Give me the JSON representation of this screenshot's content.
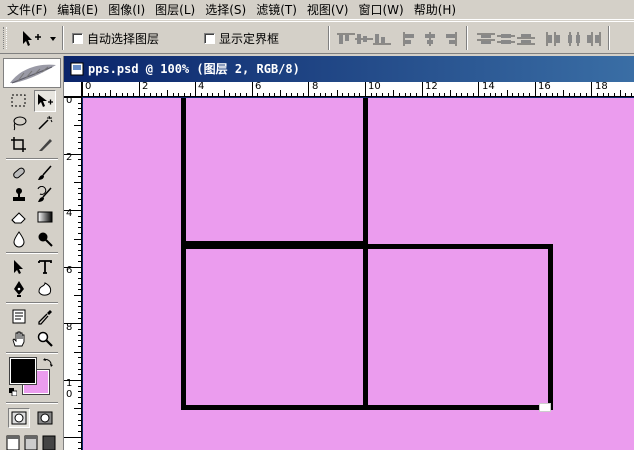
{
  "menu": {
    "items": [
      "文件(F)",
      "编辑(E)",
      "图像(I)",
      "图层(L)",
      "选择(S)",
      "滤镜(T)",
      "视图(V)",
      "窗口(W)",
      "帮助(H)"
    ]
  },
  "options": {
    "auto_select_label": "自动选择图层",
    "show_bounds_label": "显示定界框"
  },
  "document": {
    "title": "pps.psd @ 100% (图层 2, RGB/8)"
  },
  "rulers": {
    "horizontal": [
      "0",
      "2",
      "4",
      "6",
      "8",
      "10",
      "12",
      "14",
      "16",
      "18"
    ],
    "vertical": [
      "0",
      "2",
      "4",
      "6",
      "8",
      "1",
      "0"
    ]
  },
  "colors": {
    "foreground": "#000000",
    "background": "#eb9cee",
    "canvas": "#eb9cee",
    "titlebar": "#0a246a"
  },
  "icons": {
    "toolbox": [
      "marquee-icon",
      "move-icon",
      "lasso-icon",
      "magic-wand-icon",
      "crop-icon",
      "slice-icon",
      "healing-brush-icon",
      "brush-icon",
      "clone-stamp-icon",
      "history-brush-icon",
      "eraser-icon",
      "gradient-icon",
      "blur-icon",
      "dodge-icon",
      "path-select-icon",
      "type-icon",
      "pen-icon",
      "shape-icon",
      "notes-icon",
      "eyedropper-icon",
      "hand-icon",
      "zoom-icon"
    ]
  }
}
